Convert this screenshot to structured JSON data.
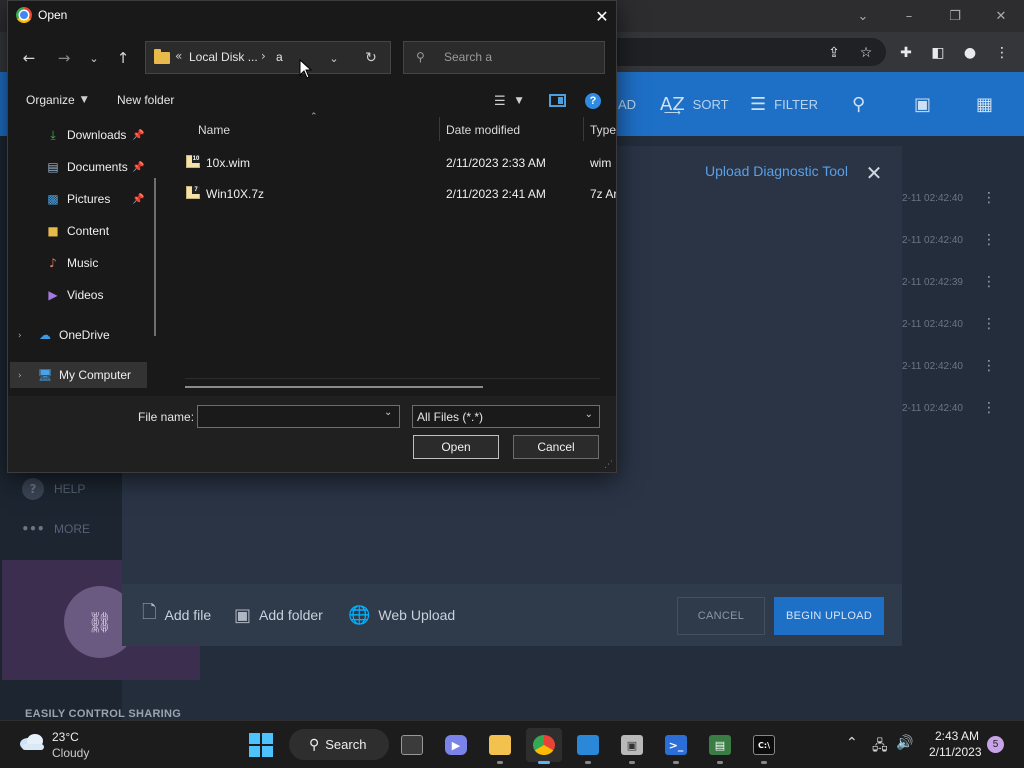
{
  "background_app": {
    "upload_dialog": {
      "title": "Upload Diagnostic Tool",
      "add_file": "Add file",
      "add_folder": "Add folder",
      "web_upload": "Web Upload",
      "cancel": "CANCEL",
      "begin_upload": "BEGIN UPLOAD"
    },
    "toolbar": {
      "sort": "SORT",
      "filter": "FILTER",
      "partial_label": "AD"
    },
    "rows": [
      {
        "time": "2-11 02:42:40"
      },
      {
        "time": "2-11 02:42:40"
      },
      {
        "time": "2-11 02:42:39"
      },
      {
        "time": "2-11 02:42:40"
      },
      {
        "time": "2-11 02:42:40"
      },
      {
        "time": "2-11 02:42:40"
      }
    ],
    "sidebar": {
      "help": "HELP",
      "more": "MORE"
    },
    "promo_caption": "EASILY CONTROL SHARING"
  },
  "dialog": {
    "title": "Open",
    "address": {
      "prefix": "«",
      "segment1": "Local Disk ...",
      "separator": "›",
      "segment2": "a"
    },
    "search_placeholder": "Search a",
    "commands": {
      "organize": "Organize",
      "new_folder": "New folder"
    },
    "nav_items": [
      {
        "label": "Downloads",
        "icon": "download-icon",
        "pinned": true
      },
      {
        "label": "Documents",
        "icon": "document-icon",
        "pinned": true
      },
      {
        "label": "Pictures",
        "icon": "pictures-icon",
        "pinned": true
      },
      {
        "label": "Content",
        "icon": "folder-icon",
        "pinned": false
      },
      {
        "label": "Music",
        "icon": "music-icon",
        "pinned": false
      },
      {
        "label": "Videos",
        "icon": "videos-icon",
        "pinned": false
      },
      {
        "label": "OneDrive",
        "icon": "cloud-icon",
        "pinned": false
      },
      {
        "label": "My Computer",
        "icon": "computer-icon",
        "pinned": false
      }
    ],
    "columns": {
      "name": "Name",
      "date_modified": "Date modified",
      "type": "Type"
    },
    "files": [
      {
        "name": "10x.wim",
        "date": "2/11/2023 2:33 AM",
        "type": "wim",
        "badge": "10"
      },
      {
        "name": "Win10X.7z",
        "date": "2/11/2023 2:41 AM",
        "type": "7z Ar",
        "badge": "7"
      }
    ],
    "file_name_label": "File name:",
    "file_name_value": "",
    "file_type": "All Files (*.*)",
    "open_button": "Open",
    "cancel_button": "Cancel"
  },
  "taskbar": {
    "weather": {
      "temp": "23°C",
      "condition": "Cloudy"
    },
    "search_label": "Search",
    "clock": {
      "time": "2:43 AM",
      "date": "2/11/2023"
    },
    "notification_count": "5"
  },
  "colors": {
    "accent": "#1e6fc6",
    "dialog_bg": "#191919",
    "taskbar_bg": "#1c1c1c"
  }
}
